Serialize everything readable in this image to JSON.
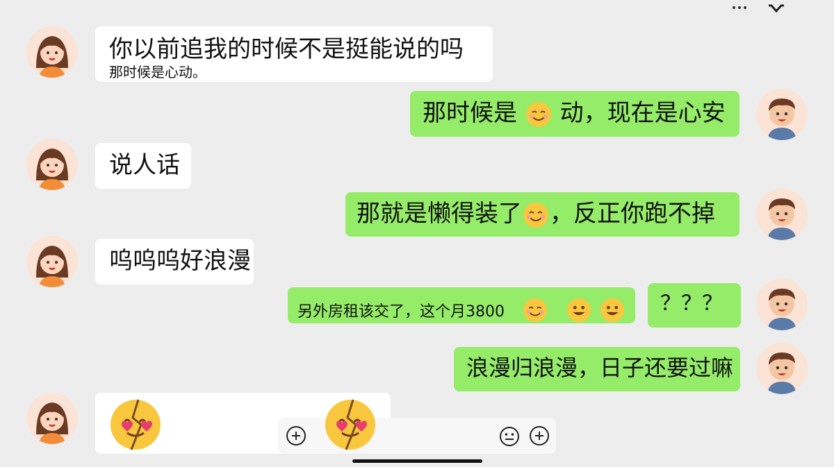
{
  "messages": {
    "m1": {
      "line1": "你以前追我的时候不是挺能说的吗",
      "line2": "那时候是心动。"
    },
    "m2": {
      "part1": "那时候是",
      "part2": "动，现在是心安"
    },
    "m3": {
      "text": "说人话"
    },
    "m4": {
      "part1": "那",
      "part2": "就是懒得装了",
      "part3": "，反正你跑不掉"
    },
    "m5": {
      "text": "呜呜呜好浪漫"
    },
    "m6": {
      "text": "另外房租该交了，这个月3800"
    },
    "m7": {
      "text": "？？？"
    },
    "m8": {
      "text": "浪漫归浪漫，日子还要过嘛"
    }
  },
  "icons": {
    "avatar_female": "girl-avatar-icon",
    "avatar_male": "boy-avatar-icon",
    "smile": "smiling-face-icon",
    "heartbroken": "broken-heart-face-icon",
    "neutral": "neutral-face-icon",
    "add": "plus-circle-icon"
  },
  "colors": {
    "green_bubble": "#95ec69",
    "white_bubble": "#ffffff",
    "background": "#ededed"
  }
}
